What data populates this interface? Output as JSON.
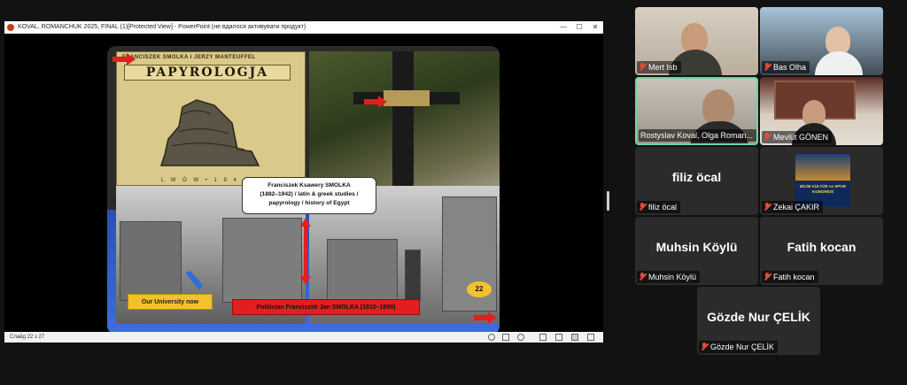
{
  "ppt": {
    "window_title": "KOVAL, ROMANCHUK 2025, FINAL (1)[Protected View] - PowerPoint (не вдалося активувати продукт)",
    "minimize": "—",
    "maximize": "☐",
    "close": "✕",
    "status_counter": "Слайд 22 з 27"
  },
  "slide": {
    "book_authors": "FRANCISZEK SMOLKA  i  JERZY MANTEUFFEL",
    "book_title": "PAPYROLOGJA",
    "book_foot": "L W Ó W  •  1 9 4",
    "caption_line1": "Franciszek Ksawery SMOLKA",
    "caption_line2": "(1882–1942) / latin & greek studies /",
    "caption_line3": "papyrology / history of Egypt",
    "university_label": "Our University now",
    "politician_label": "Politician Franciszek Jan SMOLKA  (1810–1899)",
    "slide_number": "22",
    "colors": {
      "yellow": "#f2c12e",
      "red": "#e02020",
      "blue_bg": "#2b4fb5"
    }
  },
  "participants": [
    {
      "name": "Mert Isb",
      "mic": "muted",
      "view": "video"
    },
    {
      "name": "Bas Olha",
      "mic": "muted",
      "view": "video"
    },
    {
      "name": "Rostyslav Koval, Olga Roman...",
      "mic": "on",
      "view": "video",
      "active_speaker": true
    },
    {
      "name": "Mevlüt GÖNEN",
      "mic": "muted",
      "view": "video"
    },
    {
      "name": "filiz öcal",
      "mic": "muted",
      "view": "avatar",
      "display": "filiz öcal"
    },
    {
      "name": "Zekai ÇAKIR",
      "mic": "muted",
      "view": "logo",
      "logo_text": "BİLİM KÜLTÜR ve SPOR KONGRESİ"
    },
    {
      "name": "Muhsin Köylü",
      "mic": "muted",
      "view": "avatar",
      "display": "Muhsin Köylü"
    },
    {
      "name": "Fatih kocan",
      "mic": "muted",
      "view": "avatar",
      "display": "Fatih kocan"
    },
    {
      "name": "Gözde Nur ÇELİK",
      "mic": "muted",
      "view": "avatar",
      "display": "Gözde Nur ÇELİK"
    }
  ]
}
